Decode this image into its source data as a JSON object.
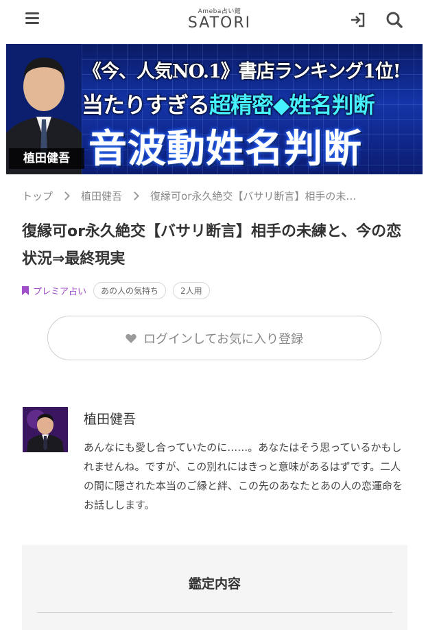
{
  "header": {
    "logo_sub": "Ameba占い館",
    "logo_main": "SATORI",
    "menu_icon": "hamburger-menu-icon",
    "login_icon": "login-icon",
    "search_icon": "search-icon"
  },
  "banner": {
    "line1": "《今、人気NO.1》書店ランキング1位!",
    "line2_a": "当たりすぎる",
    "line2_b": "超精密◆姓名判断",
    "line3": "音波動姓名判断",
    "name": "植田健吾"
  },
  "breadcrumb": {
    "items": [
      "トップ",
      "植田健吾",
      "復縁可or永久絶交【バサリ断言】相手の未…"
    ]
  },
  "title": "復縁可or永久絶交【バサリ断言】相手の未練と、今の恋状況⇒最終現実",
  "tags": {
    "premium": "プレミア占い",
    "pills": [
      "あの人の気持ち",
      "2人用"
    ]
  },
  "favorite": {
    "label": "ログインしてお気に入り登録"
  },
  "teller": {
    "name": "植田健吾",
    "description": "あんなにも愛し合っていたのに……。あなたはそう思っているかもしれませんね。ですが、この別れにはきっと意味があるはずです。二人の間に隠された本当のご縁と絆、この先のあなたとあの人の恋運命をお話しします。"
  },
  "content": {
    "title": "鑑定内容"
  },
  "colors": {
    "premium": "#a04fc8",
    "banner_bg": "#1434a8",
    "banner_accent": "#46f0ff"
  }
}
